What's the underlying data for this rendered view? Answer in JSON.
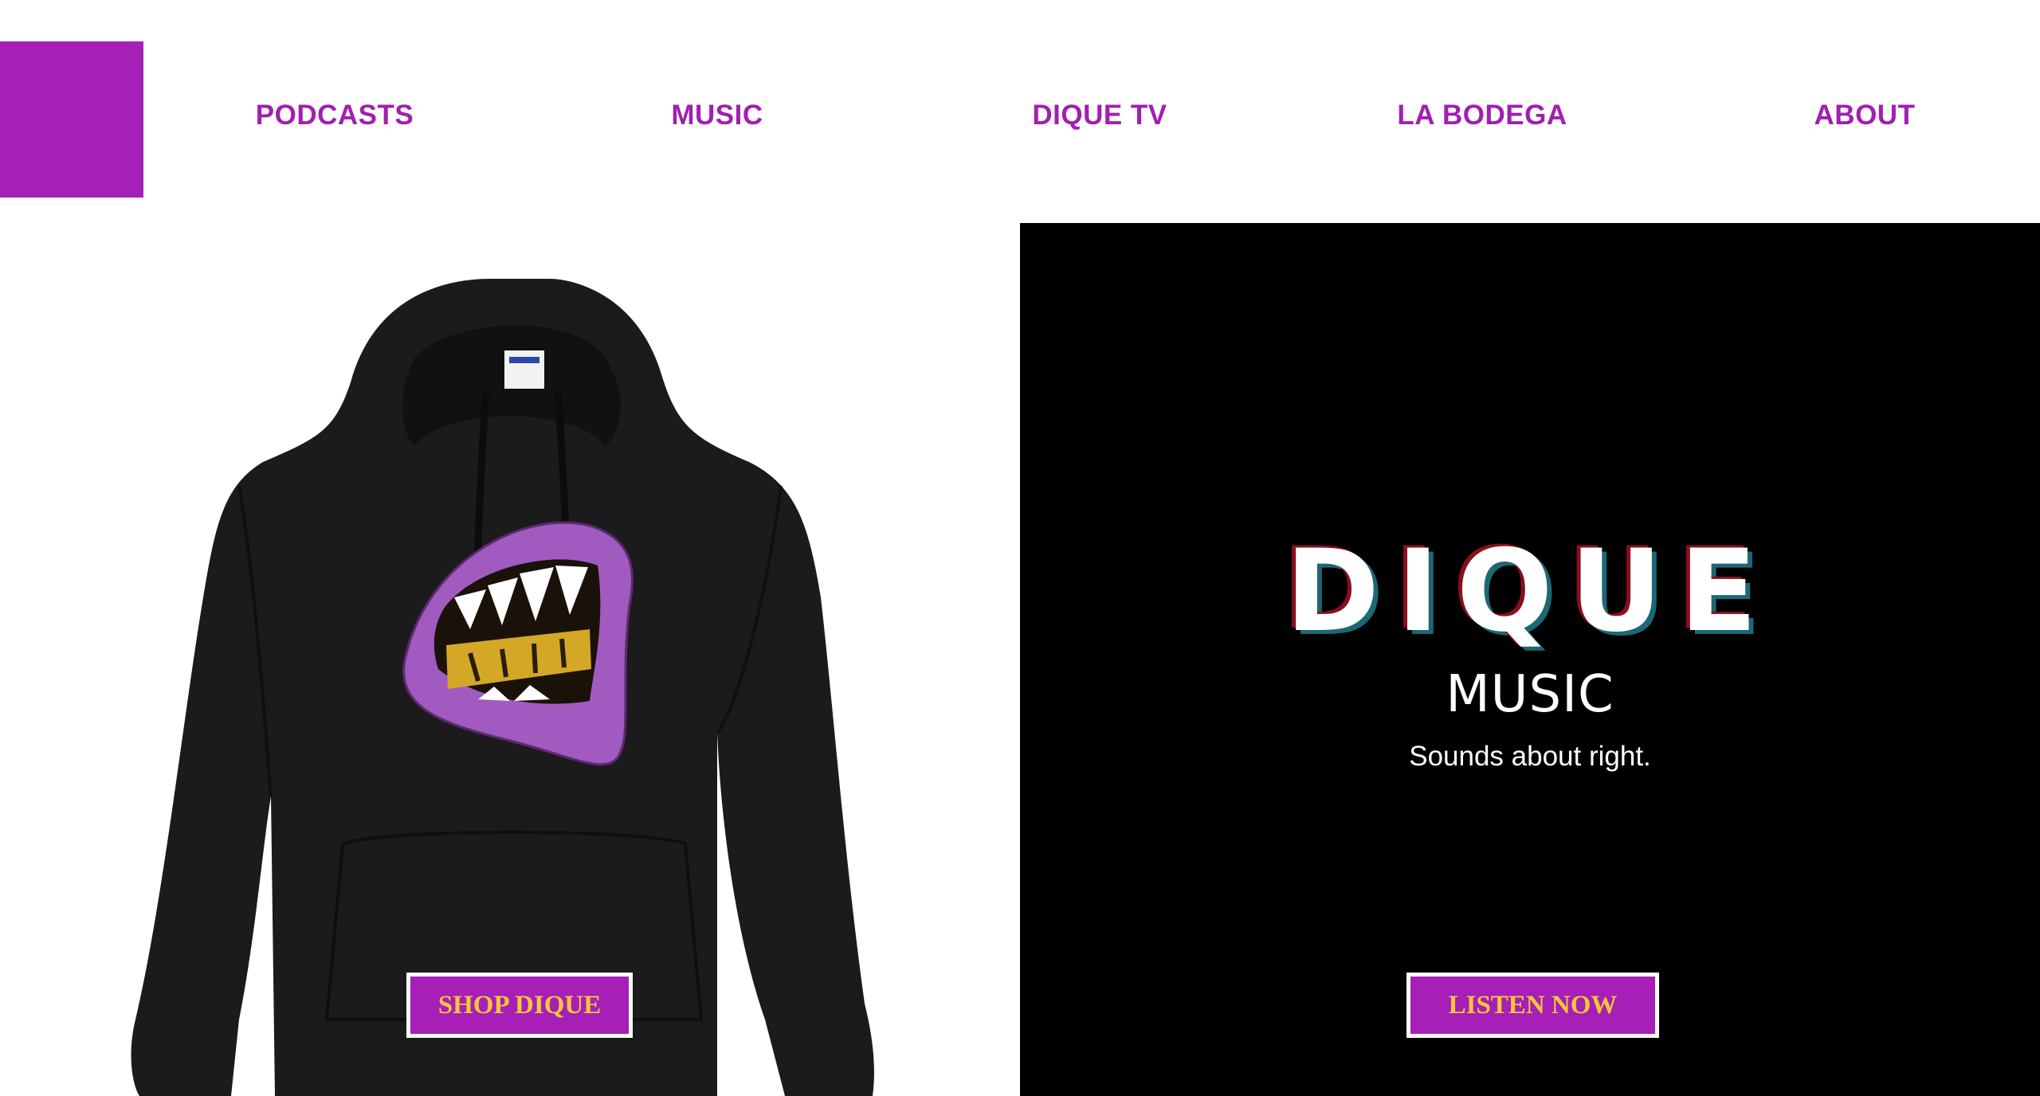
{
  "brand": {
    "accent_color": "#a61fb6",
    "button_text_color": "#f4c63a"
  },
  "nav": {
    "items": [
      {
        "label": "PODCASTS"
      },
      {
        "label": "MUSIC"
      },
      {
        "label": "DIQUE TV"
      },
      {
        "label": "LA BODEGA"
      },
      {
        "label": "ABOUT"
      }
    ]
  },
  "shop": {
    "image_icon": "hoodie-image",
    "button_label": "SHOP DIQUE"
  },
  "music": {
    "title": "DIQUE",
    "subtitle": "MUSIC",
    "tagline": "Sounds about right.",
    "button_label": "LISTEN NOW"
  }
}
